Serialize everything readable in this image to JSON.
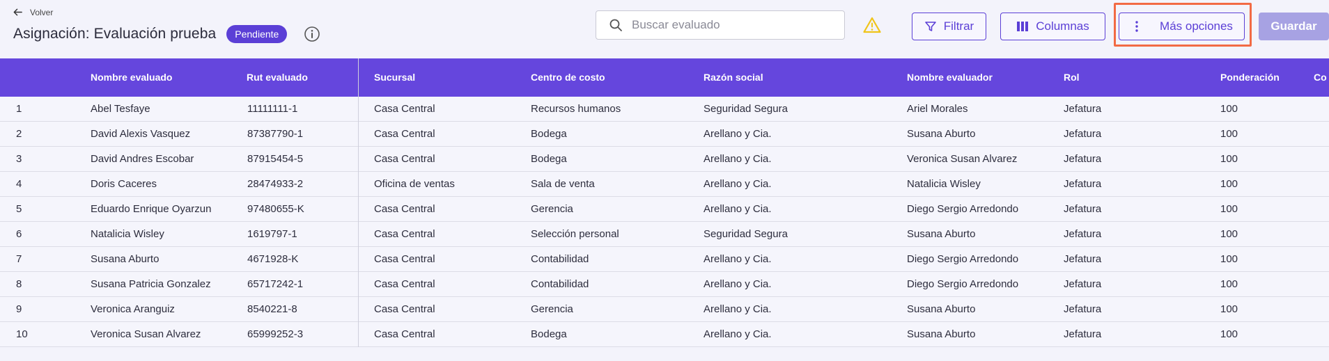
{
  "header": {
    "back_label": "Volver",
    "title": "Asignación: Evaluación prueba",
    "status_badge": "Pendiente",
    "search_placeholder": "Buscar evaluado",
    "filter_label": "Filtrar",
    "columns_label": "Columnas",
    "more_label": "Más opciones",
    "save_label": "Guardar"
  },
  "colors": {
    "accent": "#5b3fd6",
    "header_bg": "#6546dd",
    "highlight": "#f26a44",
    "warning": "#f0c419"
  },
  "table": {
    "columns": [
      "Nombre evaluado",
      "Rut evaluado",
      "Sucursal",
      "Centro de costo",
      "Razón social",
      "Nombre evaluador",
      "Rol",
      "Ponderación",
      "Co"
    ],
    "rows": [
      {
        "num": "1",
        "nombre": "Abel Tesfaye",
        "rut": "11111111-1",
        "sucursal": "Casa Central",
        "centro": "Recursos humanos",
        "razon": "Seguridad Segura",
        "evaluador": "Ariel Morales",
        "rol": "Jefatura",
        "pond": "100"
      },
      {
        "num": "2",
        "nombre": "David Alexis Vasquez",
        "rut": "87387790-1",
        "sucursal": "Casa Central",
        "centro": "Bodega",
        "razon": "Arellano y Cia.",
        "evaluador": "Susana Aburto",
        "rol": "Jefatura",
        "pond": "100"
      },
      {
        "num": "3",
        "nombre": "David Andres Escobar",
        "rut": "87915454-5",
        "sucursal": "Casa Central",
        "centro": "Bodega",
        "razon": "Arellano y Cia.",
        "evaluador": "Veronica Susan Alvarez",
        "rol": "Jefatura",
        "pond": "100"
      },
      {
        "num": "4",
        "nombre": "Doris Caceres",
        "rut": "28474933-2",
        "sucursal": "Oficina de ventas",
        "centro": "Sala de venta",
        "razon": "Arellano y Cia.",
        "evaluador": "Natalicia Wisley",
        "rol": "Jefatura",
        "pond": "100"
      },
      {
        "num": "5",
        "nombre": "Eduardo Enrique Oyarzun",
        "rut": "97480655-K",
        "sucursal": "Casa Central",
        "centro": "Gerencia",
        "razon": "Arellano y Cia.",
        "evaluador": "Diego Sergio Arredondo",
        "rol": "Jefatura",
        "pond": "100"
      },
      {
        "num": "6",
        "nombre": "Natalicia Wisley",
        "rut": "1619797-1",
        "sucursal": "Casa Central",
        "centro": "Selección personal",
        "razon": "Seguridad Segura",
        "evaluador": "Susana Aburto",
        "rol": "Jefatura",
        "pond": "100"
      },
      {
        "num": "7",
        "nombre": "Susana Aburto",
        "rut": "4671928-K",
        "sucursal": "Casa Central",
        "centro": "Contabilidad",
        "razon": "Arellano y Cia.",
        "evaluador": "Diego Sergio Arredondo",
        "rol": "Jefatura",
        "pond": "100"
      },
      {
        "num": "8",
        "nombre": "Susana Patricia Gonzalez",
        "rut": "65717242-1",
        "sucursal": "Casa Central",
        "centro": "Contabilidad",
        "razon": "Arellano y Cia.",
        "evaluador": "Diego Sergio Arredondo",
        "rol": "Jefatura",
        "pond": "100"
      },
      {
        "num": "9",
        "nombre": "Veronica Aranguiz",
        "rut": "8540221-8",
        "sucursal": "Casa Central",
        "centro": "Gerencia",
        "razon": "Arellano y Cia.",
        "evaluador": "Susana Aburto",
        "rol": "Jefatura",
        "pond": "100"
      },
      {
        "num": "10",
        "nombre": "Veronica Susan Alvarez",
        "rut": "65999252-3",
        "sucursal": "Casa Central",
        "centro": "Bodega",
        "razon": "Arellano y Cia.",
        "evaluador": "Susana Aburto",
        "rol": "Jefatura",
        "pond": "100"
      }
    ]
  }
}
